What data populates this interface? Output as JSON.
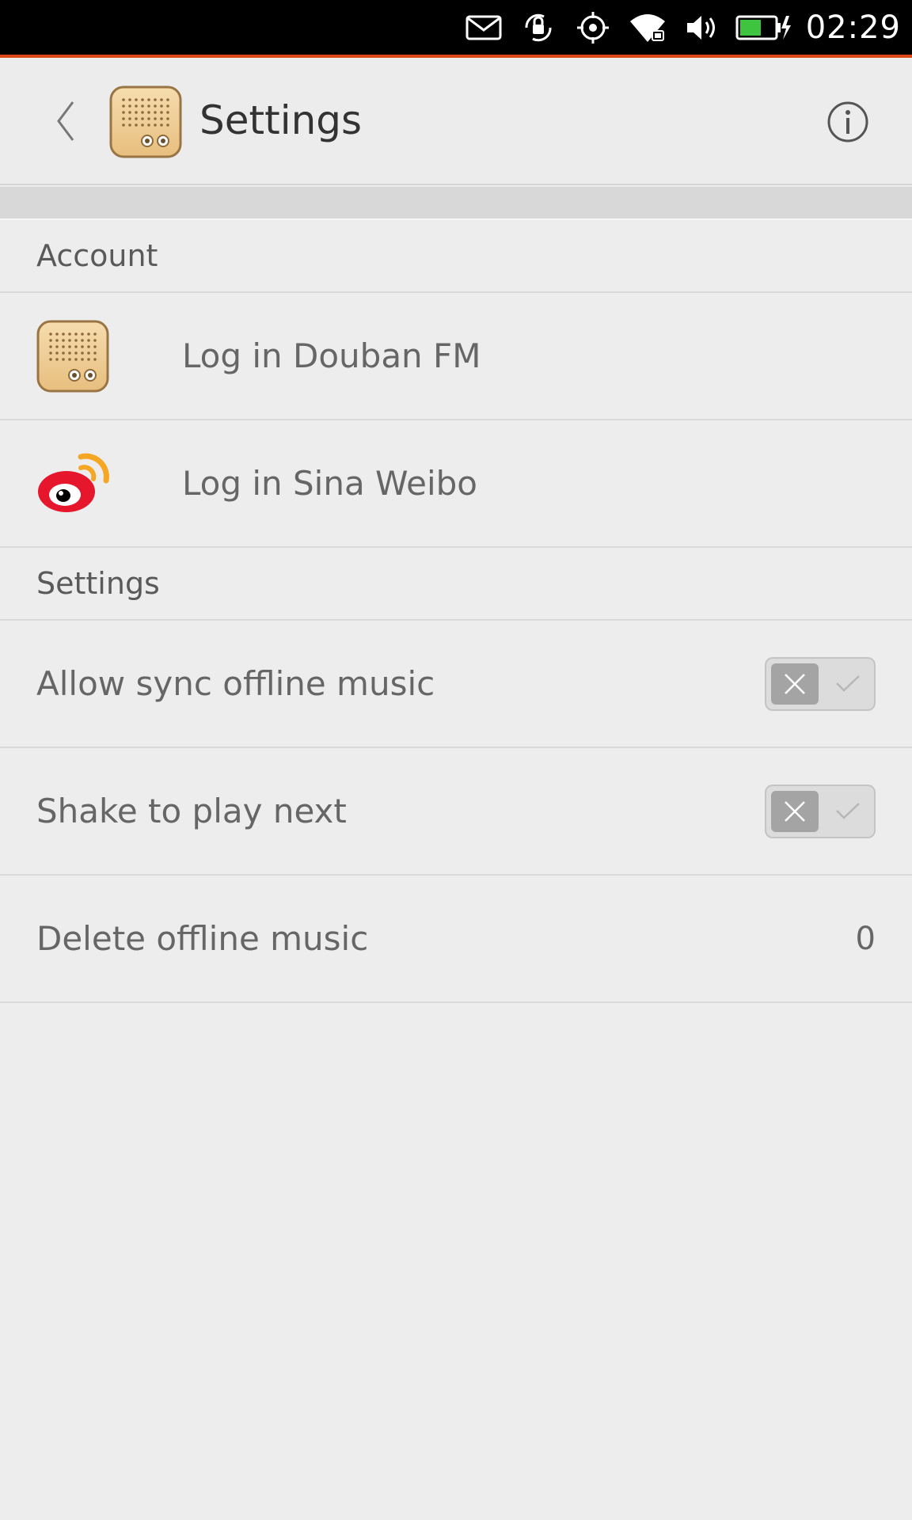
{
  "status_bar": {
    "time": "02:29",
    "icons": [
      "mail-icon",
      "rotation-lock-icon",
      "location-icon",
      "wifi-icon",
      "volume-icon",
      "battery-charging-icon"
    ]
  },
  "header": {
    "title": "Settings",
    "back_icon": "chevron-left-icon",
    "app_icon": "douban-fm-radio-icon",
    "info_icon": "info-icon"
  },
  "account": {
    "section_title": "Account",
    "items": [
      {
        "label": "Log in Douban FM",
        "icon": "douban-fm-icon"
      },
      {
        "label": "Log in Sina Weibo",
        "icon": "sina-weibo-icon"
      }
    ]
  },
  "settings": {
    "section_title": "Settings",
    "allow_sync_label": "Allow sync offline music",
    "allow_sync_enabled": false,
    "shake_label": "Shake to play next",
    "shake_enabled": false,
    "delete_label": "Delete offline music",
    "delete_count": "0"
  },
  "colors": {
    "accent": "#dd4814",
    "background": "#ededed",
    "statusbar": "#000000"
  }
}
